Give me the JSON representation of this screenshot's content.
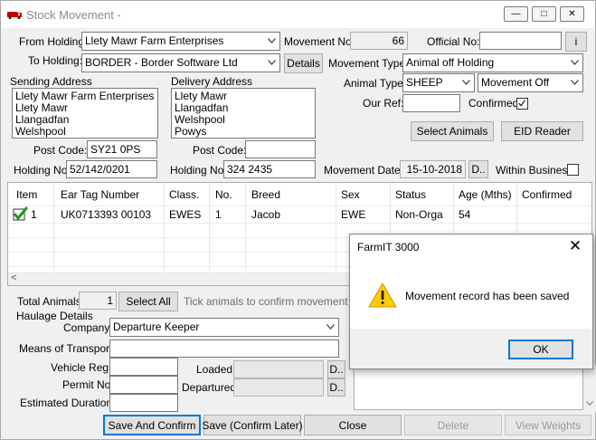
{
  "window": {
    "title": "Stock Movement -",
    "minimize_glyph": "—",
    "maximize_glyph": "□",
    "close_glyph": "✕"
  },
  "header": {
    "from_holding_label": "From Holding:",
    "from_holding_value": "Llety Mawr Farm Enterprises",
    "to_holding_label": "To Holding:",
    "to_holding_value": "BORDER - Border Software Ltd",
    "details_button": "Details",
    "movement_no_label": "Movement No:",
    "movement_no_value": "66",
    "official_no_label": "Official No:",
    "official_no_value": "",
    "info_button": "i",
    "movement_type_label": "Movement Type:",
    "movement_type_value": "Animal off Holding",
    "animal_type_label": "Animal Type:",
    "animal_type_value": "SHEEP",
    "movement_direction_value": "Movement Off",
    "our_ref_label": "Our Ref:",
    "our_ref_value": "",
    "confirmed_label": "Confirmed:",
    "confirmed_checked": true,
    "select_animals_button": "Select Animals",
    "eid_reader_button": "EID Reader"
  },
  "sending": {
    "label": "Sending Address",
    "lines": [
      "Llety Mawr Farm Enterprises",
      "Llety Mawr",
      "Llangadfan",
      "Welshpool"
    ],
    "post_code_label": "Post Code:",
    "post_code_value": "SY21 0PS",
    "holding_no_label": "Holding No:",
    "holding_no_value": "52/142/0201"
  },
  "delivery": {
    "label": "Delivery Address",
    "lines": [
      "Llety Mawr",
      "Llangadfan",
      "Welshpool",
      "Powys"
    ],
    "post_code_label": "Post Code:",
    "post_code_value": "",
    "holding_no_label": "Holding No:",
    "holding_no_value": "324 2435"
  },
  "movement_date": {
    "label": "Movement Date:",
    "value": "15-10-2018",
    "picker_button": "D..",
    "within_business_label": "Within Business",
    "within_business_checked": false
  },
  "grid": {
    "columns": [
      "Item",
      "Ear Tag Number",
      "Class.",
      "No.",
      "Breed",
      "Sex",
      "Status",
      "Age (Mths)",
      "Confirmed"
    ],
    "rows": [
      {
        "item": "1",
        "ear_tag": "UK0713393 00103",
        "class": "EWES",
        "no": "1",
        "breed": "Jacob",
        "sex": "EWE",
        "status": "Non-Orga",
        "age": "54",
        "confirmed": ""
      }
    ],
    "scroll_left_glyph": "<"
  },
  "totals": {
    "total_animals_label": "Total Animals:",
    "total_animals_value": "1",
    "select_all_button": "Select All",
    "hint": "Tick animals to confirm movement"
  },
  "haulage": {
    "section_label": "Haulage Details",
    "company_label": "Company:",
    "company_value": "Departure Keeper",
    "transport_label": "Means of Transport:",
    "transport_value": "",
    "vehicle_label": "Vehicle Reg:",
    "vehicle_value": "",
    "permit_label": "Permit No:",
    "permit_value": "",
    "duration_label": "Estimated Duration:",
    "duration_value": "",
    "loaded_label": "Loaded:",
    "loaded_value": "",
    "departured_label": "Departured:",
    "departured_value": "",
    "picker_button": "D.."
  },
  "footer": {
    "save_confirm": "Save And Confirm",
    "save_confirm_later": "Save (Confirm Later)",
    "close": "Close",
    "delete": "Delete",
    "view_weights": "View Weights"
  },
  "dialog": {
    "title": "FarmIT 3000",
    "close_glyph": "✕",
    "message": "Movement record has been saved",
    "ok_button": "OK",
    "icon": "warning-icon"
  },
  "colors": {
    "accent": "#0078d7",
    "warning": "#ffcc00",
    "check": "#1a9a1a"
  }
}
